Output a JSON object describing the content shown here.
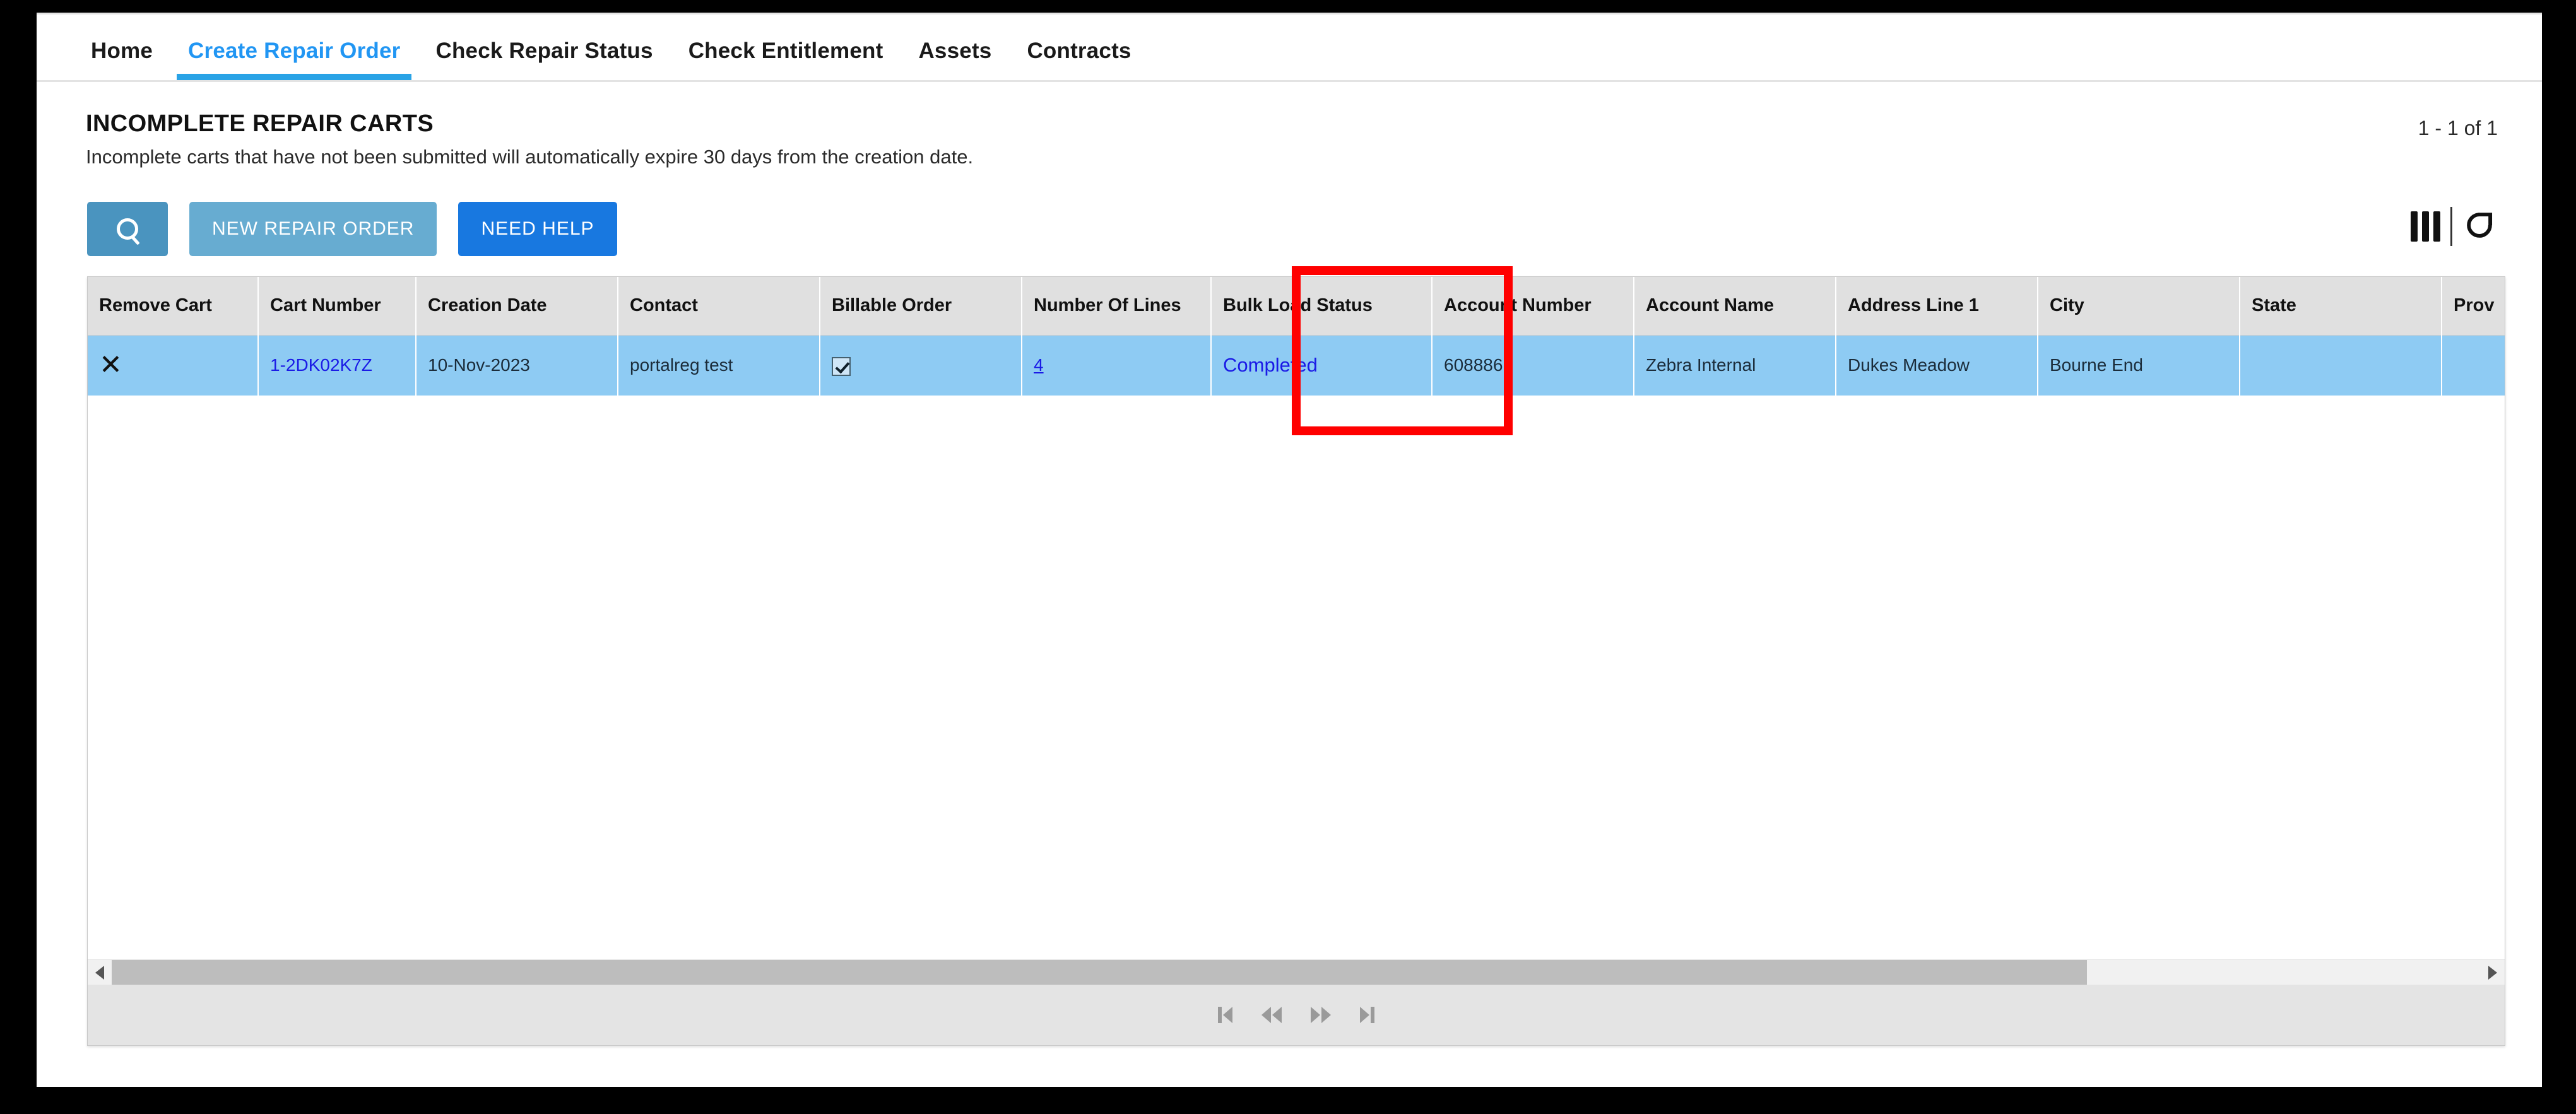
{
  "nav": {
    "tabs": [
      {
        "label": "Home",
        "active": false
      },
      {
        "label": "Create Repair Order",
        "active": true
      },
      {
        "label": "Check Repair Status",
        "active": false
      },
      {
        "label": "Check Entitlement",
        "active": false
      },
      {
        "label": "Assets",
        "active": false
      },
      {
        "label": "Contracts",
        "active": false
      }
    ]
  },
  "page": {
    "title": "INCOMPLETE REPAIR CARTS",
    "subtitle": "Incomplete carts that have not been submitted will automatically expire 30 days from the creation date.",
    "result_count": "1 - 1 of 1"
  },
  "toolbar": {
    "search_icon": "search-icon",
    "new_repair_order_label": "NEW REPAIR ORDER",
    "need_help_label": "NEED HELP",
    "search_button_color": "#4a94bf",
    "new_repair_order_color": "#67acd1",
    "need_help_color": "#1878e0"
  },
  "grid_tools": {
    "columns_icon": "columns-icon",
    "refresh_icon": "refresh-icon"
  },
  "grid": {
    "columns": [
      "Remove Cart",
      "Cart Number",
      "Creation Date",
      "Contact",
      "Billable Order",
      "Number Of Lines",
      "Bulk Load Status",
      "Account Number",
      "Account Name",
      "Address Line 1",
      "City",
      "State",
      "Prov"
    ],
    "rows": [
      {
        "remove_cart": "✕",
        "cart_number": "1-2DK02K7Z",
        "creation_date": "10-Nov-2023",
        "contact": "portalreg test",
        "billable_order": true,
        "number_of_lines": "4",
        "bulk_load_status": "Completed",
        "account_number": "6088861",
        "account_name": "Zebra Internal",
        "address_line_1": "Dukes Meadow",
        "city": "Bourne End",
        "state": "",
        "prov": ""
      }
    ],
    "selected_row_color": "#8ecbf3",
    "header_color": "#e0e0e0"
  },
  "pager": {
    "first_label": "first-page",
    "prev_label": "previous-page",
    "next_label": "next-page",
    "last_label": "last-page"
  },
  "annotation": {
    "highlight_color": "#ff0000",
    "highlight_target": "Bulk Load Status"
  }
}
